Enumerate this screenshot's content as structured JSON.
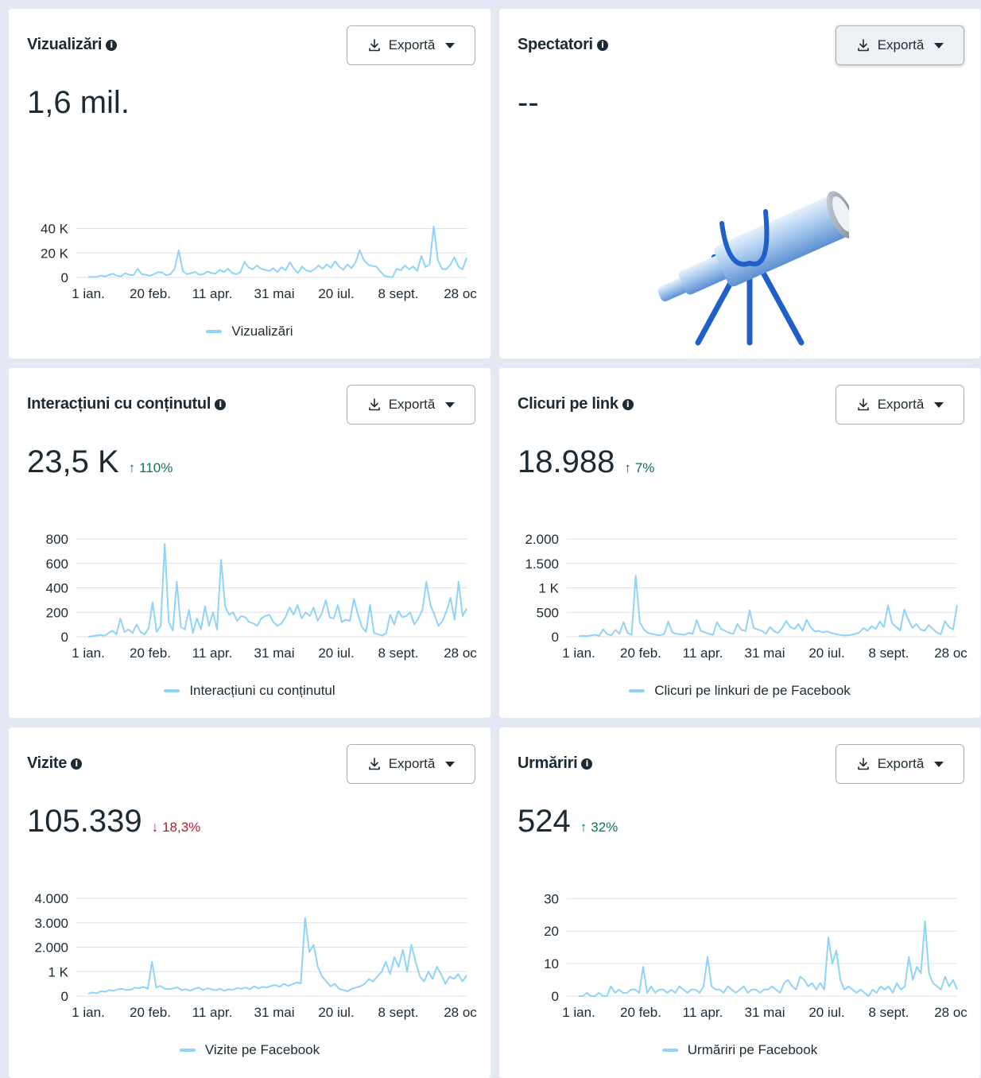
{
  "export_label": "Exportă",
  "cards": [
    {
      "title": "Vizualizări",
      "value": "1,6 mil.",
      "change": null,
      "legend": "Vizualizări",
      "yticks": [
        "0",
        "20 K",
        "40 K"
      ],
      "xticks": [
        "1 ian.",
        "20 feb.",
        "11 apr.",
        "31 mai",
        "20 iul.",
        "8 sept.",
        "28 oc"
      ]
    },
    {
      "title": "Spectatori",
      "value": "--",
      "change": null,
      "legend": null,
      "illustration": "telescope-illustration"
    },
    {
      "title": "Interacțiuni cu conținutul",
      "value": "23,5 K",
      "change": {
        "direction": "up",
        "text": "110%"
      },
      "legend": "Interacțiuni cu conținutul",
      "yticks": [
        "0",
        "200",
        "400",
        "600",
        "800"
      ],
      "xticks": [
        "1 ian.",
        "20 feb.",
        "11 apr.",
        "31 mai",
        "20 iul.",
        "8 sept.",
        "28 oc"
      ]
    },
    {
      "title": "Clicuri pe link",
      "value": "18.988",
      "change": {
        "direction": "up",
        "text": "7%"
      },
      "legend": "Clicuri pe linkuri de pe Facebook",
      "yticks": [
        "0",
        "500",
        "1 K",
        "1.500",
        "2.000"
      ],
      "xticks": [
        "1 ian.",
        "20 feb.",
        "11 apr.",
        "31 mai",
        "20 iul.",
        "8 sept.",
        "28 oc"
      ]
    },
    {
      "title": "Vizite",
      "value": "105.339",
      "change": {
        "direction": "down",
        "text": "18,3%"
      },
      "legend": "Vizite pe Facebook",
      "yticks": [
        "0",
        "1 K",
        "2.000",
        "3.000",
        "4.000"
      ],
      "xticks": [
        "1 ian.",
        "20 feb.",
        "11 apr.",
        "31 mai",
        "20 iul.",
        "8 sept.",
        "28 oc"
      ]
    },
    {
      "title": "Urmăriri",
      "value": "524",
      "change": {
        "direction": "up",
        "text": "32%"
      },
      "legend": "Urmăriri pe Facebook",
      "yticks": [
        "0",
        "10",
        "20",
        "30"
      ],
      "xticks": [
        "1 ian.",
        "20 feb.",
        "11 apr.",
        "31 mai",
        "20 iul.",
        "8 sept.",
        "28 oc"
      ]
    }
  ],
  "chart_data": [
    {
      "type": "line",
      "ylim": [
        0,
        45000
      ],
      "x_range": [
        "1 ian.",
        "28 oc"
      ],
      "series": [
        {
          "name": "Vizualizări",
          "color": "#8fd3f8",
          "values": [
            300,
            500,
            400,
            1800,
            800,
            2200,
            3500,
            1500,
            1000,
            4000,
            2500,
            2000,
            8000,
            3000,
            2500,
            1500,
            3000,
            5000,
            4500,
            2000,
            3000,
            8000,
            25000,
            6000,
            3000,
            4000,
            5000,
            2500,
            3000,
            5500,
            4000,
            3500,
            7000,
            5000,
            8000,
            4000,
            3000,
            5000,
            14500,
            9000,
            7500,
            11000,
            8000,
            7000,
            6000,
            8500,
            5000,
            9500,
            6500,
            14000,
            8000,
            4000,
            10000,
            6500,
            5500,
            7500,
            11000,
            8000,
            12000,
            9000,
            15000,
            10000,
            7000,
            12000,
            8500,
            14000,
            25000,
            16000,
            12000,
            10500,
            10000,
            5500,
            1500,
            500,
            300,
            8000,
            6500,
            11000,
            7500,
            10000,
            6000,
            20000,
            9500,
            12000,
            47000,
            16000,
            8000,
            7500,
            11500,
            18500,
            10000,
            7500,
            18000
          ]
        }
      ]
    },
    {
      "type": "line",
      "ylim": [
        0,
        800
      ],
      "x_range": [
        "1 ian.",
        "28 oc"
      ],
      "series": [
        {
          "name": "Interacțiuni cu conținutul",
          "color": "#8fd3f8",
          "values": [
            0,
            5,
            10,
            15,
            10,
            30,
            50,
            20,
            150,
            40,
            60,
            30,
            100,
            40,
            20,
            70,
            280,
            40,
            90,
            760,
            120,
            50,
            450,
            80,
            60,
            220,
            30,
            150,
            60,
            250,
            90,
            200,
            60,
            630,
            250,
            180,
            200,
            130,
            170,
            160,
            120,
            110,
            90,
            150,
            170,
            180,
            120,
            90,
            110,
            160,
            240,
            180,
            260,
            150,
            200,
            170,
            240,
            130,
            190,
            300,
            160,
            150,
            260,
            120,
            140,
            130,
            310,
            180,
            80,
            40,
            260,
            30,
            20,
            10,
            30,
            180,
            100,
            210,
            160,
            170,
            200,
            100,
            150,
            220,
            450,
            260,
            180,
            90,
            130,
            210,
            320,
            140,
            450,
            170,
            230
          ]
        }
      ]
    },
    {
      "type": "line",
      "ylim": [
        0,
        2000
      ],
      "x_range": [
        "1 ian.",
        "28 oc"
      ],
      "series": [
        {
          "name": "Clicuri pe linkuri de pe Facebook",
          "color": "#8fd3f8",
          "values": [
            10,
            20,
            15,
            30,
            40,
            20,
            150,
            50,
            30,
            140,
            60,
            300,
            80,
            40,
            1250,
            300,
            150,
            80,
            60,
            40,
            30,
            60,
            310,
            90,
            60,
            50,
            40,
            80,
            60,
            340,
            120,
            90,
            60,
            40,
            300,
            160,
            120,
            80,
            60,
            260,
            140,
            120,
            540,
            180,
            150,
            120,
            60,
            200,
            110,
            80,
            180,
            320,
            200,
            160,
            260,
            120,
            350,
            200,
            110,
            120,
            90,
            110,
            80,
            60,
            40,
            30,
            30,
            40,
            60,
            90,
            180,
            120,
            220,
            160,
            310,
            200,
            640,
            280,
            200,
            130,
            560,
            350,
            180,
            260,
            150,
            120,
            240,
            160,
            90,
            50,
            320,
            200,
            150,
            650
          ]
        }
      ]
    },
    {
      "type": "line",
      "ylim": [
        0,
        4000
      ],
      "x_range": [
        "1 ian.",
        "28 oc"
      ],
      "series": [
        {
          "name": "Vizite pe Facebook",
          "color": "#8fd3f8",
          "values": [
            100,
            150,
            120,
            200,
            180,
            250,
            220,
            280,
            300,
            250,
            260,
            350,
            320,
            380,
            300,
            1400,
            350,
            420,
            300,
            280,
            320,
            350,
            250,
            280,
            220,
            300,
            350,
            250,
            320,
            280,
            240,
            300,
            220,
            280,
            260,
            330,
            300,
            350,
            280,
            400,
            320,
            380,
            350,
            420,
            450,
            380,
            500,
            420,
            480,
            560,
            520,
            3200,
            1800,
            2100,
            1200,
            800,
            600,
            400,
            500,
            300,
            250,
            200,
            300,
            350,
            400,
            500,
            700,
            600,
            800,
            1000,
            1400,
            900,
            1600,
            1200,
            1900,
            1000,
            2100,
            1400,
            800,
            600,
            1000,
            700,
            1200,
            900,
            500,
            800,
            700,
            900,
            600,
            850
          ]
        }
      ]
    },
    {
      "type": "line",
      "ylim": [
        0,
        30
      ],
      "x_range": [
        "1 ian.",
        "28 oc"
      ],
      "series": [
        {
          "name": "Urmăriri pe Facebook",
          "color": "#8fd3f8",
          "values": [
            0,
            0,
            1,
            0,
            0,
            1,
            0,
            0,
            3,
            1,
            2,
            1,
            1,
            2,
            2,
            1,
            9,
            1,
            3,
            1,
            2,
            2,
            1,
            2,
            1,
            3,
            2,
            1,
            2,
            2,
            1,
            3,
            12,
            3,
            2,
            2,
            1,
            3,
            2,
            1,
            2,
            3,
            1,
            2,
            2,
            1,
            2,
            2,
            3,
            2,
            1,
            4,
            5,
            3,
            2,
            6,
            5,
            3,
            4,
            2,
            4,
            2,
            18,
            10,
            14,
            5,
            2,
            3,
            2,
            1,
            2,
            1,
            0,
            2,
            1,
            3,
            2,
            3,
            1,
            4,
            2,
            3,
            12,
            5,
            9,
            7,
            23,
            7,
            4,
            3,
            2,
            6,
            3,
            5,
            2
          ]
        }
      ]
    }
  ]
}
